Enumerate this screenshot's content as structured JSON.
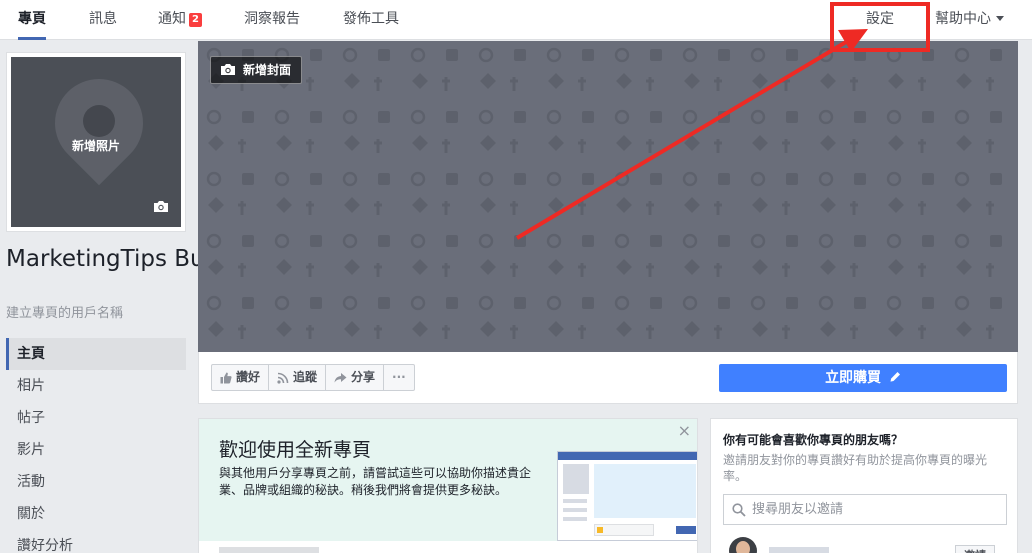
{
  "topnav": {
    "tabs": [
      {
        "label": "專頁"
      },
      {
        "label": "訊息"
      },
      {
        "label": "通知",
        "badge": "2"
      },
      {
        "label": "洞察報告"
      },
      {
        "label": "發佈工具"
      }
    ],
    "settings_label": "設定",
    "help_label": "幫助中心"
  },
  "sidebar": {
    "profile_photo_label": "新增照片",
    "page_name": "MarketingTips Burgers",
    "username_link": "建立專頁的用戶名稱",
    "items": [
      {
        "label": "主頁"
      },
      {
        "label": "相片"
      },
      {
        "label": "帖子"
      },
      {
        "label": "影片"
      },
      {
        "label": "活動"
      },
      {
        "label": "關於"
      },
      {
        "label": "讚好分析"
      }
    ]
  },
  "cover": {
    "add_cover_label": "新增封面"
  },
  "actions": {
    "like_label": "讚好",
    "follow_label": "追蹤",
    "share_label": "分享",
    "more_label": "···",
    "buy_label": "立即購買"
  },
  "welcome": {
    "title": "歡迎使用全新專頁",
    "text": "與其他用戶分享專頁之前，請嘗試這些可以協助你描述貴企業、品牌或組織的秘訣。稍後我們將會提供更多秘訣。",
    "close": "×"
  },
  "friends": {
    "title": "你有可能會喜歡你專頁的朋友嗎？",
    "desc": "邀請朋友對你的專頁讚好有助於提高你專頁的曝光率。",
    "search_placeholder": "搜尋朋友以邀請",
    "invite_label": "邀請"
  },
  "colors": {
    "accent": "#4267b2",
    "buy_button": "#4080ff",
    "highlight": "#ee2a24",
    "cover": "#6a6e7a"
  }
}
